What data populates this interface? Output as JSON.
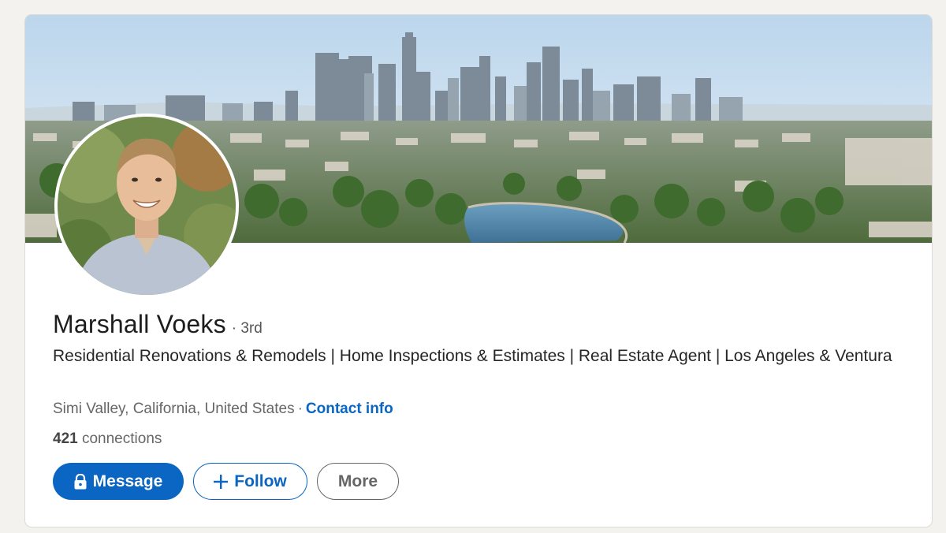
{
  "profile": {
    "name": "Marshall Voeks",
    "degree": "· 3rd",
    "headline": "Residential Renovations & Remodels | Home Inspections & Estimates | Real Estate Agent | Los Angeles & Ventura",
    "location": "Simi Valley, California, United States",
    "location_separator": "·",
    "contact_info_label": "Contact info",
    "connections_count": "421",
    "connections_label": "connections"
  },
  "actions": {
    "message_label": "Message",
    "follow_label": "Follow",
    "more_label": "More"
  },
  "icons": {
    "message": "lock-icon",
    "follow": "plus-icon"
  },
  "colors": {
    "accent": "#0a66c2",
    "page_background": "#f3f2ef",
    "secondary_text": "#666666"
  }
}
